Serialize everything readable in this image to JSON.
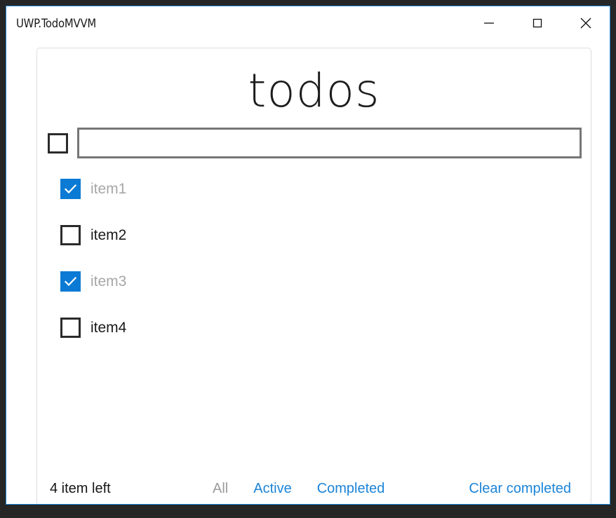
{
  "window": {
    "title": "UWP.TodoMVVM",
    "accent_color": "#1883d7",
    "controls": {
      "minimize_label": "Minimize",
      "maximize_label": "Maximize",
      "close_label": "Close"
    }
  },
  "app": {
    "heading": "todos",
    "new_todo": {
      "value": "",
      "placeholder": ""
    },
    "toggle_all": {
      "checked": false
    },
    "items": [
      {
        "label": "item1",
        "completed": true
      },
      {
        "label": "item2",
        "completed": false
      },
      {
        "label": "item3",
        "completed": false
      },
      {
        "label": "item4",
        "completed": false
      }
    ],
    "footer": {
      "items_left": "4 item left",
      "filters": [
        {
          "label": "All",
          "active": false
        },
        {
          "label": "Active",
          "active": true
        },
        {
          "label": "Completed",
          "active": true
        }
      ],
      "clear_completed": "Clear completed"
    },
    "colors": {
      "accent": "#0b7ad4",
      "link": "#1b84d8",
      "muted": "#9b9b9b",
      "completed_text": "#a7a7a7"
    }
  }
}
